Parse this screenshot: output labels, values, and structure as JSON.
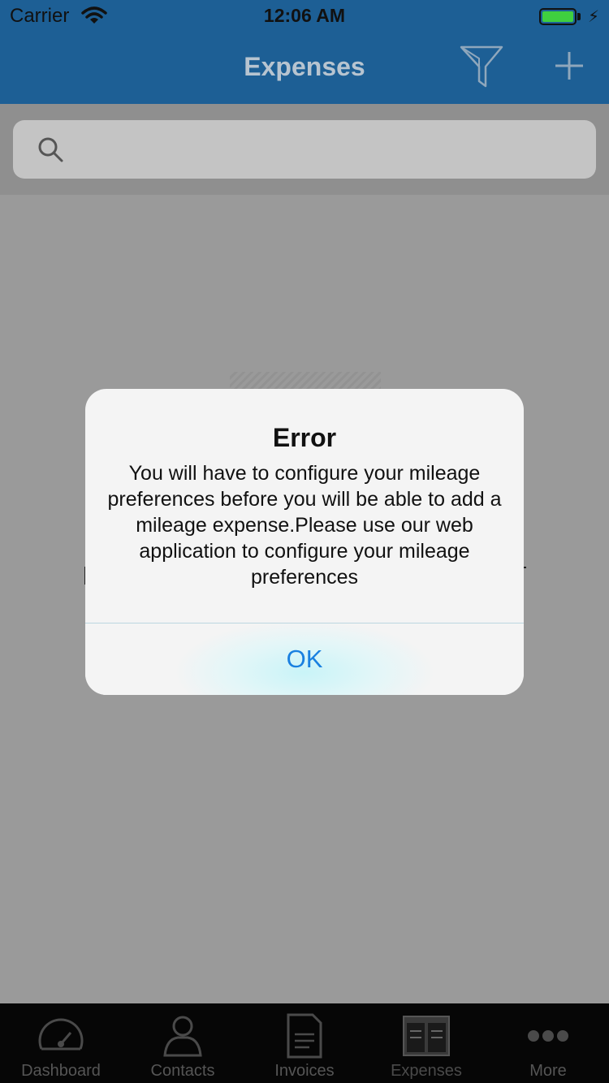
{
  "status_bar": {
    "carrier": "Carrier",
    "time": "12:06 AM",
    "battery_level": 1.0,
    "battery_color": "#3fcf3f"
  },
  "nav": {
    "title": "Expenses",
    "bar_color": "#1d5f95",
    "icons": [
      "filter-icon",
      "plus-icon"
    ]
  },
  "search": {
    "placeholder": "",
    "value": ""
  },
  "alert": {
    "title": "Error",
    "message": "You will have to configure your mileage preferences before you will be able to add a mileage expense.Please use our web application to configure your mileage preferences",
    "ok_label": "OK",
    "button_color": "#1a80e0"
  },
  "tabbar": {
    "items": [
      {
        "label": "Dashboard",
        "icon": "speedometer-icon"
      },
      {
        "label": "Contacts",
        "icon": "person-icon"
      },
      {
        "label": "Invoices",
        "icon": "document-icon"
      },
      {
        "label": "Expenses",
        "icon": "expenses-icon",
        "active": true
      },
      {
        "label": "More",
        "icon": "more-dots-icon"
      }
    ]
  }
}
